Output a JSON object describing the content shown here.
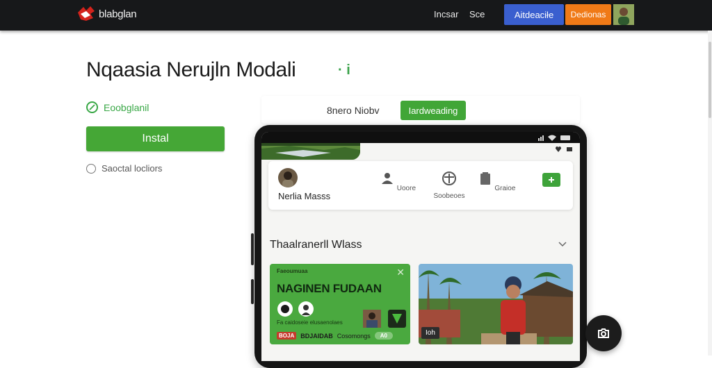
{
  "header": {
    "brand": "blabglan",
    "nav": [
      "Incsar",
      "Sce"
    ],
    "primary_button": "Aitdeaciłe",
    "secondary_button": "Dedionas"
  },
  "main": {
    "title": "Nqaasia Nerujln Modali",
    "title_marks": "· i",
    "status_text": "Eoobglanil",
    "install_label": "Instal",
    "option_label": "Saoctal locliors"
  },
  "preview": {
    "label": "8nero Niobv",
    "button": "Iardweading"
  },
  "phone": {
    "profile_name": "Nerlia Masss",
    "actions": [
      "Uoore",
      "Soobeoes",
      "Graioe"
    ],
    "section_title": "Thaalranerll Wlass",
    "promo": {
      "small": "Faeoumuaa",
      "title": "NAGINEN FUDAAN",
      "sub": "Fa caidoseie elusaenolaes",
      "badge": "BOJA",
      "bottom": "BDJAIDAB",
      "bottom2": "Cosomongs",
      "pill": "A0"
    },
    "photo_tag": "Ioh"
  },
  "colors": {
    "accent_green": "#45a736",
    "blue": "#3a5fcf",
    "orange": "#f07a17",
    "topbar": "#17181a"
  }
}
